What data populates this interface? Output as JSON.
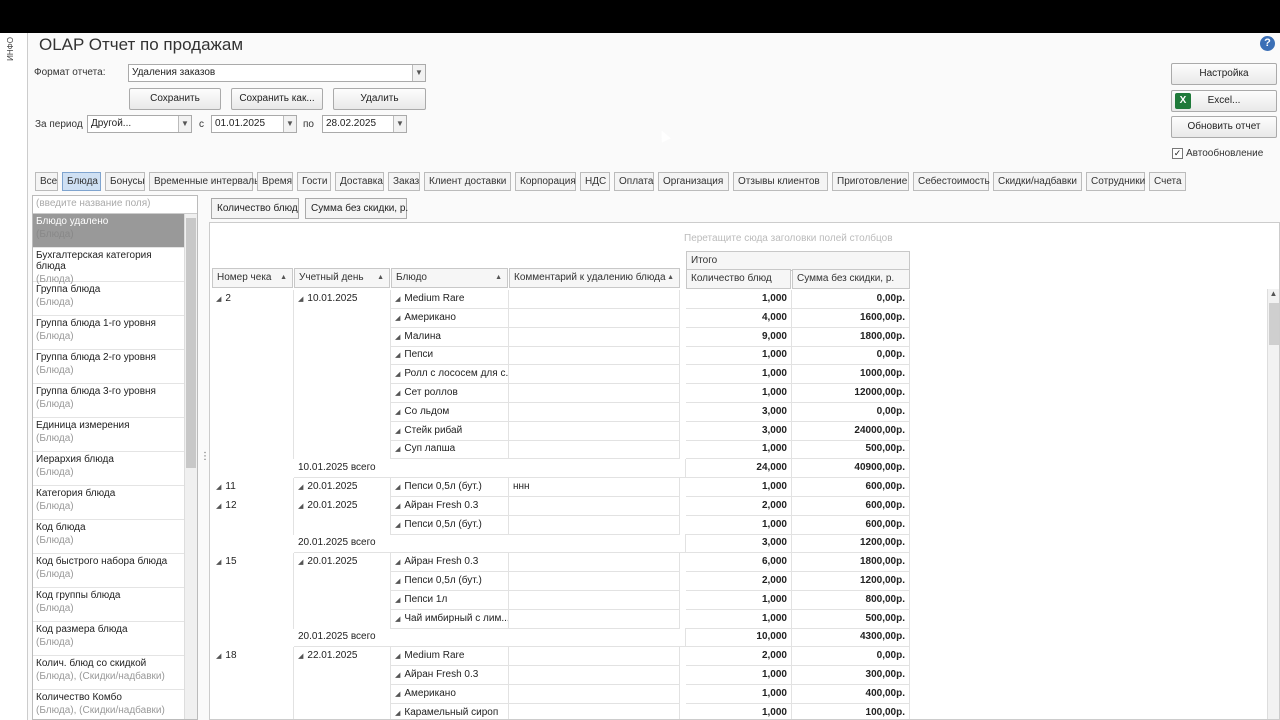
{
  "side_strip_text": "ИНФО",
  "app_title": "OLAP Отчет по продажам",
  "help_icon": "?",
  "format": {
    "label": "Формат отчета:",
    "value": "Удаления заказов"
  },
  "buttons": {
    "save": "Сохранить",
    "save_as": "Сохранить как...",
    "delete": "Удалить",
    "settings": "Настройка",
    "excel": "Excel...",
    "refresh": "Обновить отчет"
  },
  "period": {
    "label": "За период",
    "preset": "Другой...",
    "from_label": "с",
    "from": "01.01.2025",
    "to_label": "по",
    "to": "28.02.2025"
  },
  "autorefresh": {
    "label": "Автообновление",
    "checked": true
  },
  "tabs": [
    "Все",
    "Блюда",
    "Бонусы",
    "Временные интервалы",
    "Время",
    "Гости",
    "Доставка",
    "Заказ",
    "Клиент доставки",
    "Корпорация",
    "НДС",
    "Оплата",
    "Организация",
    "Отзывы клиентов",
    "Приготовление",
    "Себестоимость",
    "Скидки/надбавки",
    "Сотрудники",
    "Счета"
  ],
  "active_tab": "Блюда",
  "field_search_placeholder": "(введите название поля)",
  "fields": [
    {
      "name": "Блюдо удалено",
      "group": "(Блюда)"
    },
    {
      "name": "Бухгалтерская категория блюда",
      "group": "(Блюда)"
    },
    {
      "name": "Группа блюда",
      "group": "(Блюда)"
    },
    {
      "name": "Группа блюда 1-го уровня",
      "group": "(Блюда)"
    },
    {
      "name": "Группа блюда 2-го уровня",
      "group": "(Блюда)"
    },
    {
      "name": "Группа блюда 3-го уровня",
      "group": "(Блюда)"
    },
    {
      "name": "Единица измерения",
      "group": "(Блюда)"
    },
    {
      "name": "Иерархия блюда",
      "group": "(Блюда)"
    },
    {
      "name": "Категория блюда",
      "group": "(Блюда)"
    },
    {
      "name": "Код блюда",
      "group": "(Блюда)"
    },
    {
      "name": "Код быстрого набора блюда",
      "group": "(Блюда)"
    },
    {
      "name": "Код группы блюда",
      "group": "(Блюда)"
    },
    {
      "name": "Код размера блюда",
      "group": "(Блюда)"
    },
    {
      "name": "Колич. блюд со скидкой",
      "group": "(Блюда), (Скидки/надбавки)"
    },
    {
      "name": "Количество Комбо",
      "group": "(Блюда), (Скидки/надбавки)"
    }
  ],
  "data_chips": [
    "Количество блюд",
    "Сумма без скидки, р."
  ],
  "drop_hint": "Перетащите сюда заголовки полей столбцов",
  "headers": {
    "check": "Номер чека",
    "day": "Учетный день",
    "dish": "Блюдо",
    "comment": "Комментарий к удалению блюда",
    "total": "Итого",
    "qty": "Количество блюд",
    "sum": "Сумма без скидки, р."
  },
  "rows": [
    {
      "check": "2",
      "day": "10.01.2025",
      "dish": "Medium Rare",
      "comment": "",
      "qty": "1,000",
      "sum": "0,00р."
    },
    {
      "check": "",
      "day": "",
      "dish": "Американо",
      "comment": "",
      "qty": "4,000",
      "sum": "1600,00р."
    },
    {
      "check": "",
      "day": "",
      "dish": "Малина",
      "comment": "",
      "qty": "9,000",
      "sum": "1800,00р."
    },
    {
      "check": "",
      "day": "",
      "dish": "Пепси",
      "comment": "",
      "qty": "1,000",
      "sum": "0,00р."
    },
    {
      "check": "",
      "day": "",
      "dish": "Ролл с лососем для с...",
      "comment": "",
      "qty": "1,000",
      "sum": "1000,00р."
    },
    {
      "check": "",
      "day": "",
      "dish": "Сет роллов",
      "comment": "",
      "qty": "1,000",
      "sum": "12000,00р."
    },
    {
      "check": "",
      "day": "",
      "dish": "Со льдом",
      "comment": "",
      "qty": "3,000",
      "sum": "0,00р."
    },
    {
      "check": "",
      "day": "",
      "dish": "Стейк рибай",
      "comment": "",
      "qty": "3,000",
      "sum": "24000,00р."
    },
    {
      "check": "",
      "day": "",
      "dish": "Суп лапша",
      "comment": "",
      "qty": "1,000",
      "sum": "500,00р."
    },
    {
      "subtotal": "10.01.2025 всего",
      "qty": "24,000",
      "sum": "40900,00р."
    },
    {
      "check": "11",
      "day": "20.01.2025",
      "dish": "Пепси 0,5л (бут.)",
      "comment": "ннн",
      "qty": "1,000",
      "sum": "600,00р."
    },
    {
      "check": "12",
      "day": "20.01.2025",
      "dish": "Айран Fresh 0.3",
      "comment": "",
      "qty": "2,000",
      "sum": "600,00р."
    },
    {
      "check": "",
      "day": "",
      "dish": "Пепси 0,5л (бут.)",
      "comment": "",
      "qty": "1,000",
      "sum": "600,00р."
    },
    {
      "subtotal": "20.01.2025 всего",
      "qty": "3,000",
      "sum": "1200,00р."
    },
    {
      "check": "15",
      "day": "20.01.2025",
      "dish": "Айран Fresh 0.3",
      "comment": "",
      "qty": "6,000",
      "sum": "1800,00р."
    },
    {
      "check": "",
      "day": "",
      "dish": "Пепси 0,5л (бут.)",
      "comment": "",
      "qty": "2,000",
      "sum": "1200,00р."
    },
    {
      "check": "",
      "day": "",
      "dish": "Пепси 1л",
      "comment": "",
      "qty": "1,000",
      "sum": "800,00р."
    },
    {
      "check": "",
      "day": "",
      "dish": "Чай имбирный с лим...",
      "comment": "",
      "qty": "1,000",
      "sum": "500,00р."
    },
    {
      "subtotal": "20.01.2025 всего",
      "qty": "10,000",
      "sum": "4300,00р."
    },
    {
      "check": "18",
      "day": "22.01.2025",
      "dish": "Medium Rare",
      "comment": "",
      "qty": "2,000",
      "sum": "0,00р."
    },
    {
      "check": "",
      "day": "",
      "dish": "Айран Fresh 0.3",
      "comment": "",
      "qty": "1,000",
      "sum": "300,00р."
    },
    {
      "check": "",
      "day": "",
      "dish": "Американо",
      "comment": "",
      "qty": "1,000",
      "sum": "400,00р."
    },
    {
      "check": "",
      "day": "",
      "dish": "Карамельный сироп",
      "comment": "",
      "qty": "1,000",
      "sum": "100,00р."
    }
  ]
}
